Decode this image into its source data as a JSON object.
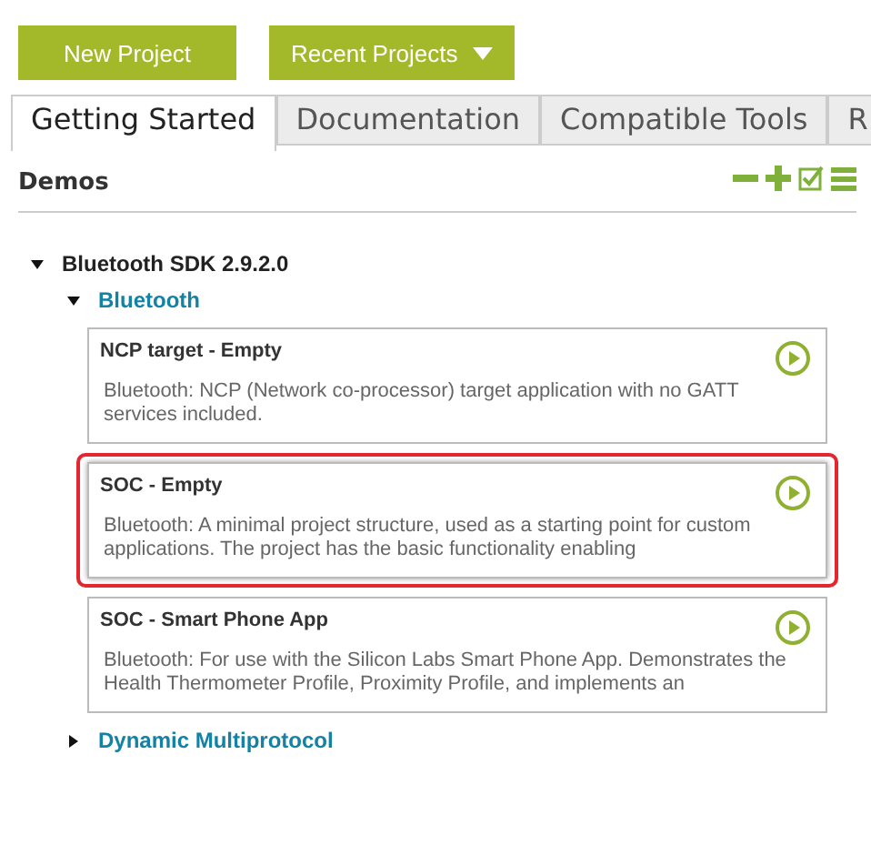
{
  "toolbar": {
    "buttons": [
      {
        "label": "New Project",
        "kind": "plain"
      },
      {
        "label": "Recent Projects",
        "kind": "dropdown"
      }
    ]
  },
  "tabs": [
    {
      "label": "Getting Started",
      "selected": true
    },
    {
      "label": "Documentation",
      "selected": false
    },
    {
      "label": "Compatible Tools",
      "selected": false
    },
    {
      "label": "R",
      "selected": false
    }
  ],
  "section": {
    "title": "Demos"
  },
  "tree": [
    {
      "label": "Bluetooth SDK 2.9.2.0",
      "expanded": true,
      "children": [
        {
          "label": "Bluetooth",
          "expanded": true,
          "children": [
            {
              "title": "NCP target - Empty",
              "description": "Bluetooth: NCP (Network co-processor) target application with no GATT services included.",
              "highlighted": false
            },
            {
              "title": "SOC - Empty",
              "description": "Bluetooth: A minimal project structure, used as a starting point for custom applications. The project has the basic functionality enabling",
              "highlighted": true
            },
            {
              "title": "SOC - Smart Phone App",
              "description": "Bluetooth: For use with the Silicon Labs Smart Phone App. Demonstrates the Health Thermometer Profile, Proximity Profile, and implements an",
              "highlighted": false
            }
          ]
        },
        {
          "label": "Dynamic Multiprotocol",
          "expanded": false
        }
      ]
    }
  ]
}
